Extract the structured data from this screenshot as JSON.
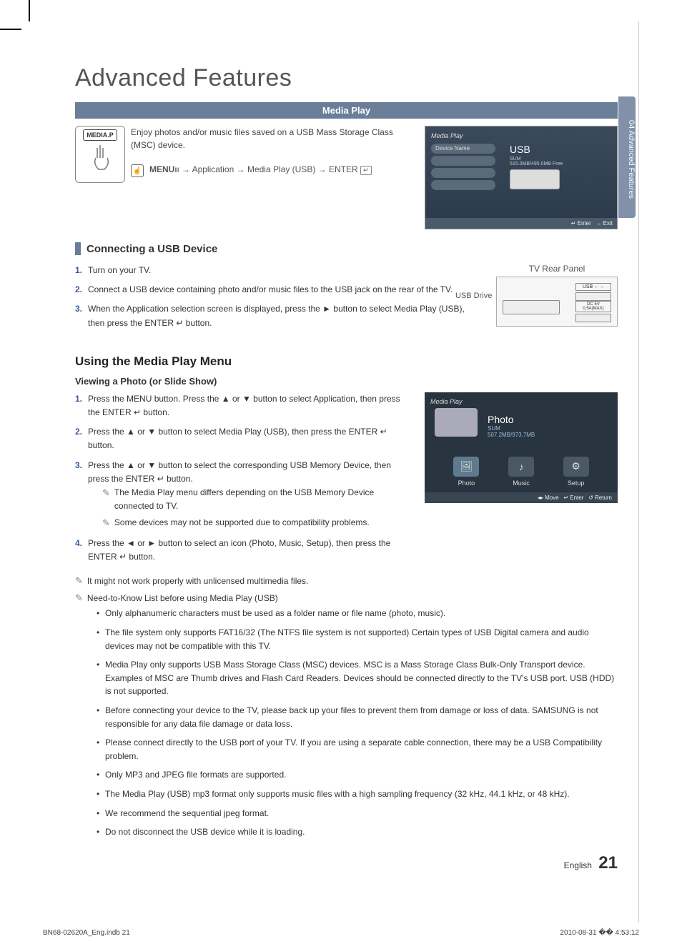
{
  "page_title": "Advanced Features",
  "side_tab": "04    Advanced Features",
  "section_bar": "Media Play",
  "intro": {
    "mediap_label": "MEDIA.P",
    "desc": "Enjoy photos and/or music files saved on a USB Mass Storage Class (MSC) device.",
    "menu_path_prefix": "MENU",
    "menu_path_1": " → Application → Media Play (USB) → ENTER",
    "enter_symbol": "↵"
  },
  "osd1": {
    "brand": "Media Play",
    "slot_label": "Device Name",
    "usb": "USB",
    "sum": "SUM",
    "free": "515.0MB/495.0MB Free",
    "enter": "↵ Enter",
    "exit": "→ Exit"
  },
  "connecting": {
    "heading": "Connecting a USB Device",
    "steps": [
      "Turn on your TV.",
      "Connect a USB device containing photo and/or music files to the USB jack on the rear of the TV.",
      "When the Application selection screen is displayed, press the ► button to select Media Play (USB), then press the ENTER ↵ button."
    ],
    "rear_label": "TV Rear Panel",
    "usb_drive": "USB Drive",
    "usb_port_label": "USB ←→",
    "usb_spec": "DC 5V 0.5A(MAX)"
  },
  "using": {
    "heading": "Using the Media Play Menu",
    "sub1": "Viewing a Photo (or Slide Show)",
    "steps": [
      "Press the MENU button. Press the ▲ or ▼ button to select Application, then press the ENTER ↵ button.",
      "Press the ▲ or ▼ button to select Media Play (USB), then press the ENTER ↵ button.",
      "Press the ▲ or ▼ button to select the corresponding USB Memory Device, then press the ENTER ↵ button.",
      "Press the ◄ or ► button to select an icon (Photo, Music, Setup), then press the ENTER ↵ button."
    ],
    "sub_notes": [
      "The Media Play menu differs depending on the USB Memory Device connected to TV.",
      "Some devices may not be supported due to compatibility problems."
    ]
  },
  "osd2": {
    "brand": "Media Play",
    "title": "Photo",
    "sum": "SUM",
    "size": "507.2MB/973.7MB",
    "items": {
      "photo": "Photo",
      "music": "Music",
      "setup": "Setup"
    },
    "move": "◂▸ Move",
    "enter": "↵ Enter",
    "return": "↺ Return"
  },
  "notes": {
    "note1": "It might not work properly with unlicensed multimedia files.",
    "note2": "Need-to-Know List before using Media Play (USB)",
    "bullets": [
      "Only alphanumeric characters must be used as a folder name or file name (photo, music).",
      "The file system only supports FAT16/32 (The NTFS file system is not supported) Certain types of USB Digital camera and audio devices may not be compatible with this TV.",
      "Media Play only supports USB Mass Storage Class (MSC) devices. MSC is a Mass Storage Class Bulk-Only Transport device. Examples of MSC are Thumb drives and Flash Card Readers. Devices should be connected directly to the TV's USB port. USB (HDD) is not supported.",
      "Before connecting your device to the TV, please back up your files to prevent them from damage or loss of data. SAMSUNG is not responsible for any data file damage or data loss.",
      "Please connect directly to the USB port of your TV. If you are using a separate cable connection, there may be a USB Compatibility problem.",
      "Only MP3 and JPEG file formats are supported.",
      "The Media Play (USB) mp3 format only supports music files with a high sampling frequency (32 kHz, 44.1 kHz, or 48 kHz).",
      "We recommend the sequential jpeg format.",
      "Do not disconnect the USB device while it is loading."
    ]
  },
  "footer": {
    "lang": "English",
    "page_no": "21",
    "print_left": "BN68-02620A_Eng.indb   21",
    "print_right": "2010-08-31   �� 4:53:12"
  }
}
